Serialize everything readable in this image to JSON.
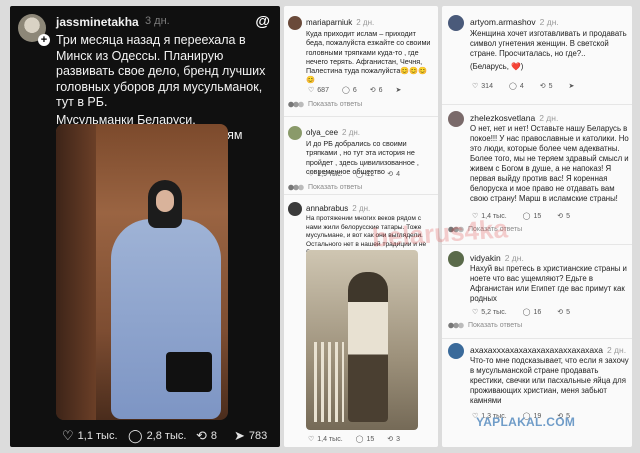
{
  "left_post": {
    "username": "jassminetakha",
    "time": "3 дн.",
    "text_p1": "Три месяца назад я переехала в Минск из Одессы. Планирую развивать свое дело, бренд лучших головных уборов для мусульманок, тут в РБ.",
    "text_p2": "Мусульманки Беларуси, подписывайтесь. Всем Ассалям алейкум",
    "likes": "1,1 тыс.",
    "comments": "2,8 тыс.",
    "reposts": "8",
    "shares": "783"
  },
  "middle": {
    "c1": {
      "user": "mariaparniuk",
      "time": "2 дн.",
      "text": "Куда приходит ислам – приходит беда, пожалуйста езжайте со своими головными тряпками куда-то , где нечего терять. Афганистан, Чечня, Палестина туда пожалуйста😊😊😊😊",
      "likes": "687",
      "comments": "6",
      "reposts": "6"
    },
    "reply_label": "Показать ответы",
    "c2": {
      "user": "olya_cee",
      "time": "2 дн.",
      "text": "И до РБ добрались со своими тряпками , но тут эта история не пройдет , здесь цивилизованное , современное общество",
      "likes": "1,9 тыс.",
      "comments": "12",
      "reposts": "4"
    },
    "c3": {
      "user": "annabrabus",
      "time": "2 дн.",
      "text": "На протяжении многих веков рядом с нами жили белорусские татары. Тоже мусульмане, и вот как они выглядели. Остального нет в нашей традиции и не будет.",
      "likes": "1,4 тыс.",
      "comments": "15",
      "reposts": "3"
    }
  },
  "right": {
    "c1": {
      "user": "artyom.armashov",
      "time": "2 дн.",
      "text": "Женщина хочет изготавливать и продавать символ угнетения женщин. В светской стране. Просчиталась, но где?..",
      "text2": "(Беларусь, ❤️)",
      "likes": "314",
      "comments": "4",
      "reposts": "5"
    },
    "c2": {
      "user": "zhelezkosvetlana",
      "time": "2 дн.",
      "text": "О нет, нет и нет! Оставьте нашу Беларусь в покое!!! У нас православные и католики. Но это люди, которые более чем адекватны. Более того, мы не теряем здравый смысл и живем с Богом в душе, а не напоказ! Я первая выйду против вас! Я коренная белоруска и мое право не отдавать вам свою страну! Марш в исламские страны!",
      "likes": "1,4 тыс.",
      "comments": "15",
      "reposts": "5"
    },
    "c3": {
      "user": "vidyakin",
      "time": "2 дн.",
      "text": "Нахуй вы претесь в христианские страны и ноете что вас ущемляют? Едьте в Афганистан или Египет где вас примут как родных",
      "likes": "5,2 тыс.",
      "comments": "16",
      "reposts": "5"
    },
    "c4": {
      "user": "ахахахххахахахахахахаххахахаха",
      "time": "2 дн.",
      "text": "Что-то мне подсказывает, что если я захочу в мусульманской стране продавать крестики, свечки или пасхальные яйца для проживающих христиан, меня забьют камнями",
      "likes": "1,3 тыс.",
      "comments": "19",
      "reposts": "5"
    },
    "reply_label": "Показать ответы"
  },
  "watermark": "belarus4ka",
  "site": "YAPLAKAL.COM"
}
